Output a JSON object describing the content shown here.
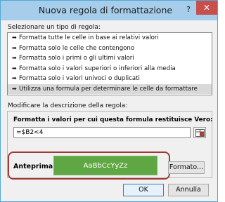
{
  "window": {
    "title": "Nuova regola di formattazione",
    "help_label": "?",
    "close_label": "✕"
  },
  "rule_type": {
    "label": "Selezionare un tipo di regola:",
    "items": [
      {
        "label": "Formatta tutte le celle in base ai relativi valori",
        "selected": false
      },
      {
        "label": "Formatta solo le celle che contengono",
        "selected": false
      },
      {
        "label": "Formatta solo i primi o gli ultimi valori",
        "selected": false
      },
      {
        "label": "Formatta solo i valori superiori o inferiori alla media",
        "selected": false
      },
      {
        "label": "Formatta solo i valori univoci o duplicati",
        "selected": false
      },
      {
        "label": "Utilizza una formula per determinare le celle da formattare",
        "selected": true
      }
    ]
  },
  "description": {
    "label": "Modificare la descrizione della regola:",
    "formula_label": "Formatta i valori per cui questa formula restituisce Vero:",
    "formula_value": "=$B2<4"
  },
  "preview": {
    "label": "Anteprima:",
    "sample_text": "AaBbCcYyZz",
    "fill_color": "#5fa742",
    "text_color": "#ffffff"
  },
  "buttons": {
    "format": "Formato...",
    "ok": "OK",
    "cancel": "Annulla"
  },
  "icons": {
    "rule_item": "right-arrow-icon",
    "collapse": "range-collapse-icon"
  }
}
